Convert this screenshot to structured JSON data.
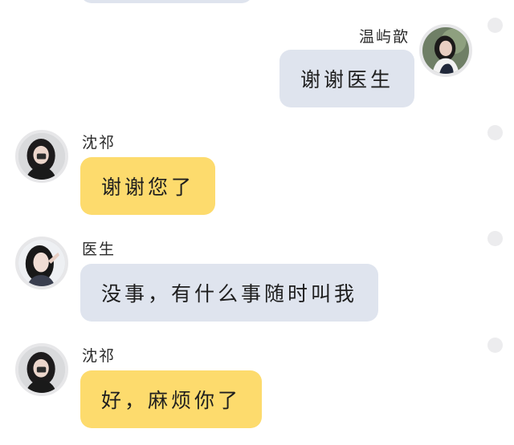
{
  "messages": [
    {
      "sender": "温屿歆",
      "text": "谢谢医生",
      "side": "right",
      "bubble_color": "#dfe4ee"
    },
    {
      "sender": "沈祁",
      "text": "谢谢您了",
      "side": "left",
      "bubble_color": "#fddb6d"
    },
    {
      "sender": "医生",
      "text": "没事，有什么事随时叫我",
      "side": "left",
      "bubble_color": "#dfe4ee"
    },
    {
      "sender": "沈祁",
      "text": "好，麻烦你了",
      "side": "left",
      "bubble_color": "#fddb6d"
    }
  ],
  "colors": {
    "gray_bubble": "#dfe4ee",
    "yellow_bubble": "#fddb6d",
    "select_circle": "#ececee",
    "avatar_ring": "#e7e7e9"
  },
  "icons": [
    "avatar-image",
    "select-circle"
  ]
}
